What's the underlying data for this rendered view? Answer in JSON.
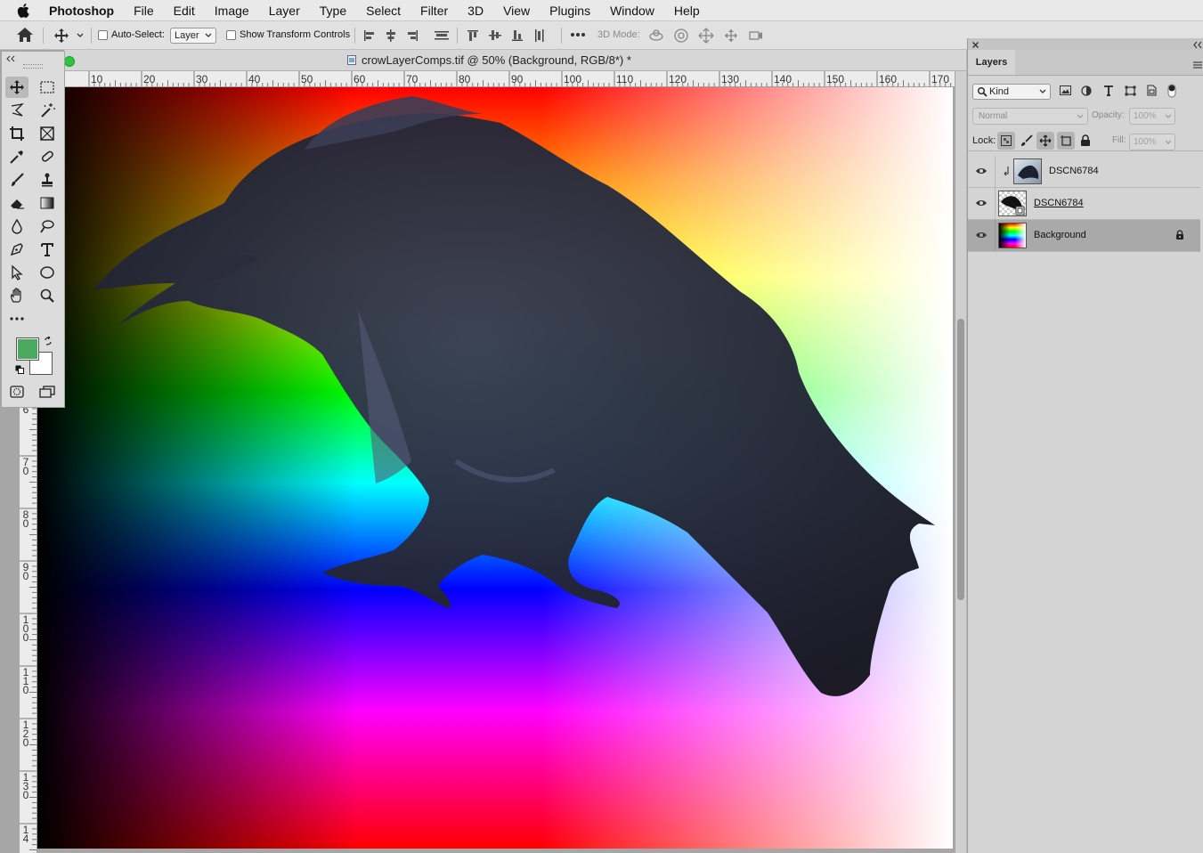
{
  "menubar": {
    "app": "Photoshop",
    "items": [
      "File",
      "Edit",
      "Image",
      "Layer",
      "Type",
      "Select",
      "Filter",
      "3D",
      "View",
      "Plugins",
      "Window",
      "Help"
    ]
  },
  "options": {
    "auto_select_label": "Auto-Select:",
    "auto_select_value": "Layer",
    "transform_label": "Show Transform Controls",
    "mode_3d_label": "3D Mode:"
  },
  "document": {
    "tab_title": "crowLayerComps.tif @ 50% (Background, RGB/8*) *",
    "hruler": [
      "10",
      "20",
      "30",
      "40",
      "50",
      "60",
      "70",
      "80",
      "90",
      "100",
      "110",
      "120",
      "130",
      "140",
      "150",
      "160",
      "170"
    ],
    "vruler": [
      [
        "6"
      ],
      [
        "7",
        "0"
      ],
      [
        "8",
        "0"
      ],
      [
        "9",
        "0"
      ],
      [
        "1",
        "0",
        "0"
      ],
      [
        "1",
        "1",
        "0"
      ],
      [
        "1",
        "2",
        "0"
      ],
      [
        "1",
        "3",
        "0"
      ],
      [
        "1",
        "4"
      ]
    ]
  },
  "tools": {
    "foreground_color": "#4ba85f",
    "background_color": "#ffffff"
  },
  "layers_panel": {
    "tab_label": "Layers",
    "filter_kind": "Kind",
    "blend_mode": "Normal",
    "opacity_label": "Opacity:",
    "opacity_value": "100%",
    "lock_label": "Lock:",
    "fill_label": "Fill:",
    "fill_value": "100%",
    "layers": [
      {
        "name": "DSCN6784",
        "clipped": true,
        "selected": false,
        "locked": false
      },
      {
        "name": "DSCN6784",
        "smart_object": true,
        "selected": false,
        "locked": false
      },
      {
        "name": "Background",
        "selected": true,
        "locked": true
      }
    ]
  }
}
